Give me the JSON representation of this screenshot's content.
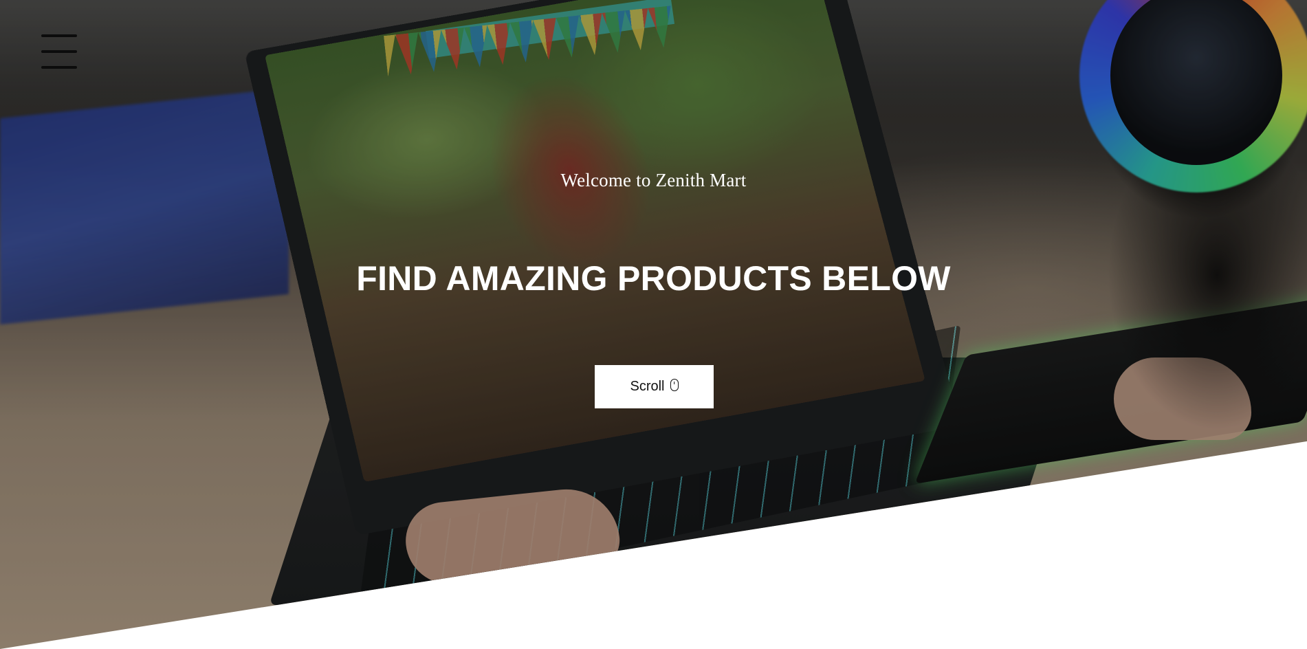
{
  "nav": {
    "menu_icon": "hamburger-menu-icon"
  },
  "hero": {
    "welcome_text": "Welcome to Zenith Mart",
    "headline": "FIND AMAZING PRODUCTS BELOW",
    "scroll_label": "Scroll",
    "scroll_icon": "mouse-icon",
    "background_image": "gaming-laptop-desk-photo"
  },
  "colors": {
    "button_background": "#ffffff",
    "text_on_hero": "#ffffff",
    "page_background": "#ffffff"
  }
}
